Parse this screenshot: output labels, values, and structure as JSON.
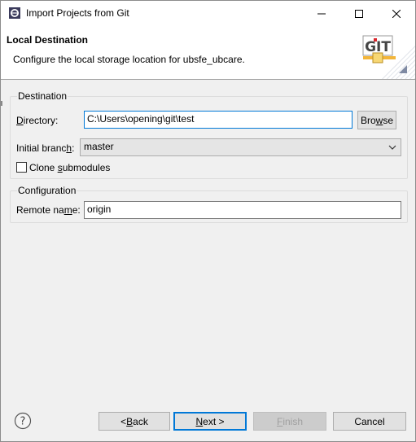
{
  "window": {
    "title": "Import Projects from Git",
    "icons": {
      "app": "eclipse-icon",
      "minimize": "minimize-icon",
      "maximize": "maximize-icon",
      "close": "close-icon"
    }
  },
  "banner": {
    "title": "Local Destination",
    "description": "Configure the local storage location for ubsfe_ubcare.",
    "logo_icon": "git-logo-icon",
    "logo_text": "GIT"
  },
  "destination": {
    "group_title": "Destination",
    "directory_label_u": "D",
    "directory_label_rest": "irectory:",
    "directory_value": "C:\\Users\\opening\\git\\test",
    "browse_pre": "Bro",
    "browse_u": "w",
    "browse_post": "se",
    "branch_label_pre": "Initial branc",
    "branch_label_u": "h",
    "branch_label_post": ":",
    "branch_value": "master",
    "clone_pre": "Clone ",
    "clone_u": "s",
    "clone_post": "ubmodules",
    "clone_checked": false
  },
  "configuration": {
    "group_title": "Configuration",
    "remote_label_pre": "Remote na",
    "remote_label_u": "m",
    "remote_label_post": "e:",
    "remote_value": "origin"
  },
  "footer": {
    "help_icon": "help-icon",
    "back_pre": "< ",
    "back_u": "B",
    "back_post": "ack",
    "next_u": "N",
    "next_post": "ext >",
    "finish_u": "F",
    "finish_post": "inish",
    "cancel": "Cancel"
  }
}
